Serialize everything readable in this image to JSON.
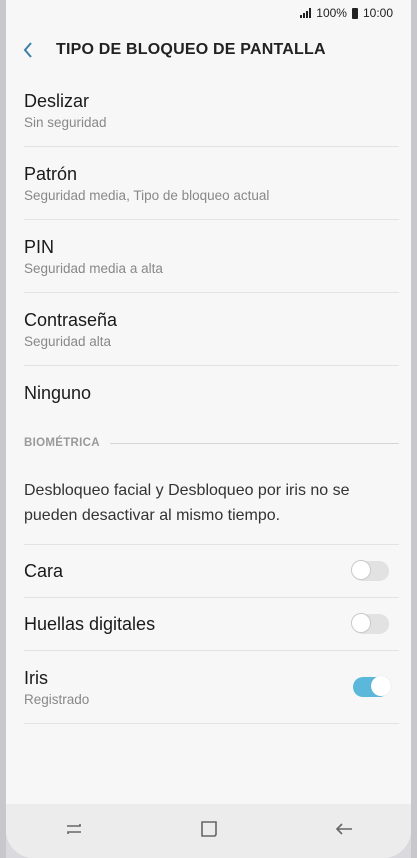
{
  "status": {
    "battery": "100%",
    "time": "10:00"
  },
  "header": {
    "title": "TIPO DE BLOQUEO DE PANTALLA"
  },
  "options": [
    {
      "title": "Deslizar",
      "subtitle": "Sin seguridad"
    },
    {
      "title": "Patrón",
      "subtitle": "Seguridad media, Tipo de bloqueo actual"
    },
    {
      "title": "PIN",
      "subtitle": "Seguridad media a alta"
    },
    {
      "title": "Contraseña",
      "subtitle": "Seguridad alta"
    },
    {
      "title": "Ninguno"
    }
  ],
  "biometrics": {
    "section_label": "BIOMÉTRICA",
    "note": "Desbloqueo facial y Desbloqueo por iris no se pueden desactivar al mismo tiempo.",
    "items": [
      {
        "title": "Cara",
        "enabled": false
      },
      {
        "title": "Huellas digitales",
        "enabled": false
      },
      {
        "title": "Iris",
        "subtitle": "Registrado",
        "enabled": true
      }
    ]
  },
  "colors": {
    "accent": "#5bb8db",
    "background": "#f7f7f7"
  },
  "nav": {
    "icons": [
      "recent-apps-icon",
      "home-icon",
      "back-icon"
    ]
  }
}
